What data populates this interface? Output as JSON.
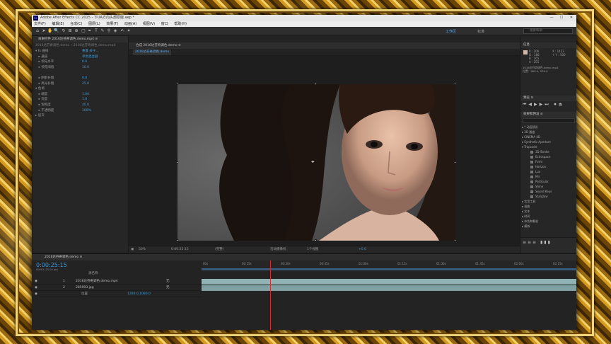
{
  "window": {
    "title": "Adobe After Effects CC 2015 - 下UA方向头部原版.aep *",
    "min": "—",
    "max": "☐",
    "close": "✕"
  },
  "menu": [
    "文件(F)",
    "编辑(E)",
    "合成(C)",
    "图层(L)",
    "效果(T)",
    "动画(A)",
    "视图(V)",
    "窗口",
    "帮助(H)"
  ],
  "toolbar": {
    "workspace_1": "工作区",
    "workspace_2": "标准",
    "search_placeholder": "搜索帮助"
  },
  "effect_controls": {
    "tab": "效果控件 2016达芬奇调色.demo.mp4 ≡",
    "sub": "2016达芬奇调色.demo • 2016达芬奇调色.demo.mp4",
    "rows": [
      {
        "label": "▾ fx 曲线",
        "value": "重置 关于..."
      },
      {
        "label": "　▸ 通道",
        "value": "单色混合器"
      },
      {
        "label": "　▸ 领先水平",
        "value": "0.0"
      },
      {
        "label": "　▸ 领先阈值",
        "value": "10.0"
      },
      {
        "label": "",
        "value": ""
      },
      {
        "label": "　▸ 阴影补偿",
        "value": "0.0"
      },
      {
        "label": "　▸ 高光补偿",
        "value": "25.0"
      },
      {
        "label": "▾ 色调",
        "value": ""
      },
      {
        "label": "　▸ 端度",
        "value": "1.00"
      },
      {
        "label": "　▸ 亮度",
        "value": "1.0"
      },
      {
        "label": "　▸ 饱和度",
        "value": "40.0"
      },
      {
        "label": "　▸ 不透明度",
        "value": "100%"
      },
      {
        "label": "▸ 层次",
        "value": ""
      }
    ]
  },
  "composition": {
    "tab": "合成 2016达芬奇调色.demo ≡",
    "sub_tab": "2016达芬奇调色.demo"
  },
  "viewer_bar": {
    "zoom": "50%",
    "timecode": "0:00:25:15",
    "resolution": "(完整)",
    "view": "活动摄像机",
    "views": "1个视图",
    "offset": "+0.0"
  },
  "info_panel": {
    "tab": "信息",
    "tab2": "音频",
    "r": "R : 206",
    "g": "G : 186",
    "b": "B : 165",
    "a": "A : 255",
    "x": "X : 1423",
    "y": "+ Y : 500",
    "line1": "2016达芬奇调色.demo.mp4",
    "line2": "位置：960.0, 539.0"
  },
  "preview_panel": {
    "tab": "预览 ≡"
  },
  "effects_panel": {
    "tab": "效果和预设 ≡",
    "search": "",
    "items": [
      {
        "t": "▸ * 动画预设",
        "sub": false
      },
      {
        "t": "▸ 3D 通道",
        "sub": false
      },
      {
        "t": "▸ CINEMA 4D",
        "sub": false
      },
      {
        "t": "▸ Synthetic Aperture",
        "sub": false
      },
      {
        "t": "▾ Trapcode",
        "sub": false
      },
      {
        "t": "3D Stroke",
        "sub": true
      },
      {
        "t": "Echospace",
        "sub": true
      },
      {
        "t": "Form",
        "sub": true
      },
      {
        "t": "Horizon",
        "sub": true
      },
      {
        "t": "Lux",
        "sub": true
      },
      {
        "t": "Mir",
        "sub": true
      },
      {
        "t": "Particular",
        "sub": true
      },
      {
        "t": "Shine",
        "sub": true
      },
      {
        "t": "Sound Keys",
        "sub": true
      },
      {
        "t": "Starglow",
        "sub": true
      },
      {
        "t": "▸ 实用工具",
        "sub": false
      },
      {
        "t": "▸ 扭曲",
        "sub": false
      },
      {
        "t": "▸ 文本",
        "sub": false
      },
      {
        "t": "▸ 时间",
        "sub": false
      },
      {
        "t": "▸ 杂色和颗粒",
        "sub": false
      },
      {
        "t": "▸ 模拟",
        "sub": false
      }
    ]
  },
  "timeline": {
    "tab": "2016达芬奇调色.demo ≡",
    "timecode": "0:00:25:15",
    "fps": "00615 (25.00 fps)",
    "header_cols": "源名称",
    "ticks": [
      "00s",
      "00:15s",
      "00:30s",
      "00:45s",
      "01:00s",
      "01:15s",
      "01:30s",
      "01:45s",
      "02:00s",
      "02:15s"
    ],
    "layers": [
      {
        "num": "1",
        "name": "2016达芬奇调色.demo.mp4",
        "mode": "无"
      },
      {
        "num": "2",
        "name": "285993.jpg",
        "mode": "无"
      },
      {
        "num": "",
        "name": "位置",
        "mode": "1280.0,1080.0"
      }
    ]
  }
}
